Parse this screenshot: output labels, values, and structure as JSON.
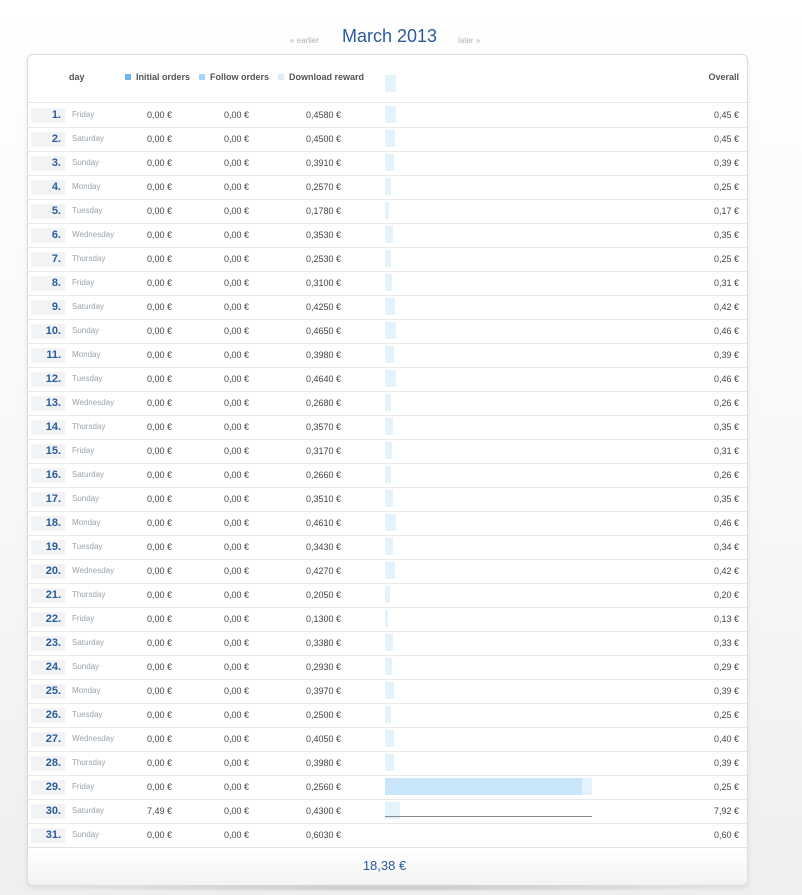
{
  "nav": {
    "earlier": "« earlier",
    "title": "March 2013",
    "later": "later »"
  },
  "header": {
    "day": "day",
    "overall": "Overall"
  },
  "legend": [
    {
      "label": "Initial orders",
      "color": "#6fb6ec"
    },
    {
      "label": "Follow orders",
      "color": "#a8d4f5"
    },
    {
      "label": "Download reward",
      "color": "#dcedf9"
    }
  ],
  "colors": {
    "bar": "#e4f2fc",
    "bar_selected": "#c9e6fb",
    "accent": "#2a5b9b"
  },
  "selected_day": 29,
  "rows": [
    {
      "num": "1.",
      "name": "Friday",
      "initial": "0,00 €",
      "follow": "0,00 €",
      "download": "0,4580 €",
      "overall": "0,45 €"
    },
    {
      "num": "2.",
      "name": "Saturday",
      "initial": "0,00 €",
      "follow": "0,00 €",
      "download": "0,4500 €",
      "overall": "0,45 €"
    },
    {
      "num": "3.",
      "name": "Sunday",
      "initial": "0,00 €",
      "follow": "0,00 €",
      "download": "0,3910 €",
      "overall": "0,39 €"
    },
    {
      "num": "4.",
      "name": "Monday",
      "initial": "0,00 €",
      "follow": "0,00 €",
      "download": "0,2570 €",
      "overall": "0,25 €"
    },
    {
      "num": "5.",
      "name": "Tuesday",
      "initial": "0,00 €",
      "follow": "0,00 €",
      "download": "0,1780 €",
      "overall": "0,17 €"
    },
    {
      "num": "6.",
      "name": "Wednesday",
      "initial": "0,00 €",
      "follow": "0,00 €",
      "download": "0,3530 €",
      "overall": "0,35 €"
    },
    {
      "num": "7.",
      "name": "Thursday",
      "initial": "0,00 €",
      "follow": "0,00 €",
      "download": "0,2530 €",
      "overall": "0,25 €"
    },
    {
      "num": "8.",
      "name": "Friday",
      "initial": "0,00 €",
      "follow": "0,00 €",
      "download": "0,3100 €",
      "overall": "0,31 €"
    },
    {
      "num": "9.",
      "name": "Saturday",
      "initial": "0,00 €",
      "follow": "0,00 €",
      "download": "0,4250 €",
      "overall": "0,42 €"
    },
    {
      "num": "10.",
      "name": "Sunday",
      "initial": "0,00 €",
      "follow": "0,00 €",
      "download": "0,4650 €",
      "overall": "0,46 €"
    },
    {
      "num": "11.",
      "name": "Monday",
      "initial": "0,00 €",
      "follow": "0,00 €",
      "download": "0,3980 €",
      "overall": "0,39 €"
    },
    {
      "num": "12.",
      "name": "Tuesday",
      "initial": "0,00 €",
      "follow": "0,00 €",
      "download": "0,4640 €",
      "overall": "0,46 €"
    },
    {
      "num": "13.",
      "name": "Wednesday",
      "initial": "0,00 €",
      "follow": "0,00 €",
      "download": "0,2680 €",
      "overall": "0,26 €"
    },
    {
      "num": "14.",
      "name": "Thursday",
      "initial": "0,00 €",
      "follow": "0,00 €",
      "download": "0,3570 €",
      "overall": "0,35 €"
    },
    {
      "num": "15.",
      "name": "Friday",
      "initial": "0,00 €",
      "follow": "0,00 €",
      "download": "0,3170 €",
      "overall": "0,31 €"
    },
    {
      "num": "16.",
      "name": "Saturday",
      "initial": "0,00 €",
      "follow": "0,00 €",
      "download": "0,2660 €",
      "overall": "0,26 €"
    },
    {
      "num": "17.",
      "name": "Sunday",
      "initial": "0,00 €",
      "follow": "0,00 €",
      "download": "0,3510 €",
      "overall": "0,35 €"
    },
    {
      "num": "18.",
      "name": "Monday",
      "initial": "0,00 €",
      "follow": "0,00 €",
      "download": "0,4610 €",
      "overall": "0,46 €"
    },
    {
      "num": "19.",
      "name": "Tuesday",
      "initial": "0,00 €",
      "follow": "0,00 €",
      "download": "0,3430 €",
      "overall": "0,34 €"
    },
    {
      "num": "20.",
      "name": "Wednesday",
      "initial": "0,00 €",
      "follow": "0,00 €",
      "download": "0,4270 €",
      "overall": "0,42 €"
    },
    {
      "num": "21.",
      "name": "Thursday",
      "initial": "0,00 €",
      "follow": "0,00 €",
      "download": "0,2050 €",
      "overall": "0,20 €"
    },
    {
      "num": "22.",
      "name": "Friday",
      "initial": "0,00 €",
      "follow": "0,00 €",
      "download": "0,1300 €",
      "overall": "0,13 €"
    },
    {
      "num": "23.",
      "name": "Saturday",
      "initial": "0,00 €",
      "follow": "0,00 €",
      "download": "0,3380 €",
      "overall": "0,33 €"
    },
    {
      "num": "24.",
      "name": "Sunday",
      "initial": "0,00 €",
      "follow": "0,00 €",
      "download": "0,2930 €",
      "overall": "0,29 €"
    },
    {
      "num": "25.",
      "name": "Monday",
      "initial": "0,00 €",
      "follow": "0,00 €",
      "download": "0,3970 €",
      "overall": "0,39 €"
    },
    {
      "num": "26.",
      "name": "Tuesday",
      "initial": "0,00 €",
      "follow": "0,00 €",
      "download": "0,2500 €",
      "overall": "0,25 €"
    },
    {
      "num": "27.",
      "name": "Wednesday",
      "initial": "0,00 €",
      "follow": "0,00 €",
      "download": "0,4050 €",
      "overall": "0,40 €"
    },
    {
      "num": "28.",
      "name": "Thursday",
      "initial": "0,00 €",
      "follow": "0,00 €",
      "download": "0,3980 €",
      "overall": "0,39 €"
    },
    {
      "num": "29.",
      "name": "Friday",
      "initial": "0,00 €",
      "follow": "0,00 €",
      "download": "0,2560 €",
      "overall": "0,25 €"
    },
    {
      "num": "30.",
      "name": "Saturday",
      "initial": "7,49 €",
      "follow": "0,00 €",
      "download": "0,4300 €",
      "overall": "7,92 €"
    },
    {
      "num": "31.",
      "name": "Sunday",
      "initial": "0,00 €",
      "follow": "0,00 €",
      "download": "0,6030 €",
      "overall": "0,60 €"
    }
  ],
  "total": "18,38 €"
}
